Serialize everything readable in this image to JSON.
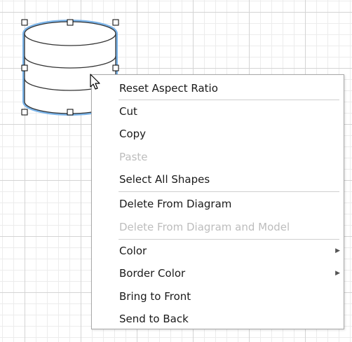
{
  "shape": {
    "type": "database-cylinder",
    "stroke_color": "#333333",
    "selection_color": "#7ab3e8"
  },
  "context_menu": {
    "items": [
      {
        "label": "Reset Aspect Ratio",
        "enabled": true
      },
      {
        "label": "Cut",
        "enabled": true
      },
      {
        "label": "Copy",
        "enabled": true
      },
      {
        "label": "Paste",
        "enabled": false
      },
      {
        "label": "Select All Shapes",
        "enabled": true
      },
      {
        "label": "Delete From Diagram",
        "enabled": true
      },
      {
        "label": "Delete From Diagram and Model",
        "enabled": false
      },
      {
        "label": "Color",
        "enabled": true,
        "submenu": true
      },
      {
        "label": "Border Color",
        "enabled": true,
        "submenu": true
      },
      {
        "label": "Bring to Front",
        "enabled": true
      },
      {
        "label": "Send to Back",
        "enabled": true
      }
    ],
    "submenu_icon": "triangle-right-icon"
  }
}
